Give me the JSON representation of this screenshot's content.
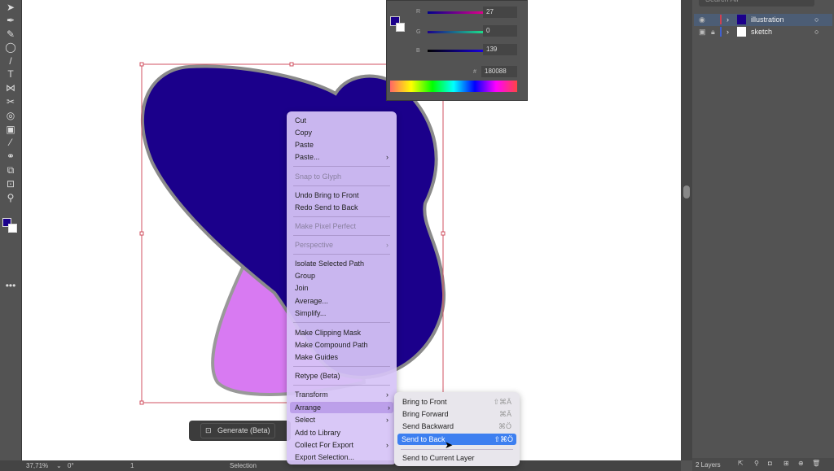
{
  "colors": {
    "navy": "#1b008b",
    "pink": "#d87af2",
    "accent": "#3d7ff0"
  },
  "color_panel": {
    "r_label": "R",
    "g_label": "G",
    "b_label": "B",
    "r": "27",
    "g": "0",
    "b": "139",
    "hex": "180088",
    "hex_symbol": "#"
  },
  "layers": {
    "search_placeholder": "Search All",
    "items": [
      {
        "name": "illustration",
        "color": "#d04050"
      },
      {
        "name": "sketch",
        "color": "#4060d0"
      }
    ],
    "count": "2 Layers"
  },
  "status": {
    "zoom": "37,71%",
    "rotation": "0°",
    "artboard": "1",
    "tool": "Selection"
  },
  "generate": {
    "label": "Generate (Beta)"
  },
  "context_menu": {
    "items": [
      "Cut",
      "Copy",
      "Paste",
      "Paste...",
      "Snap to Glyph",
      "Undo Bring to Front",
      "Redo Send to Back",
      "Make Pixel Perfect",
      "Perspective",
      "Isolate Selected Path",
      "Group",
      "Join",
      "Average...",
      "Simplify...",
      "Make Clipping Mask",
      "Make Compound Path",
      "Make Guides",
      "Retype (Beta)",
      "Transform",
      "Arrange",
      "Select",
      "Add to Library",
      "Collect For Export",
      "Export Selection..."
    ]
  },
  "arrange_menu": {
    "items": [
      {
        "label": "Bring to Front",
        "shortcut": "⇧⌘Ä"
      },
      {
        "label": "Bring Forward",
        "shortcut": "⌘Ä"
      },
      {
        "label": "Send Backward",
        "shortcut": "⌘Ö"
      },
      {
        "label": "Send to Back",
        "shortcut": "⇧⌘Ö"
      },
      {
        "label": "Send to Current Layer",
        "shortcut": ""
      }
    ]
  }
}
